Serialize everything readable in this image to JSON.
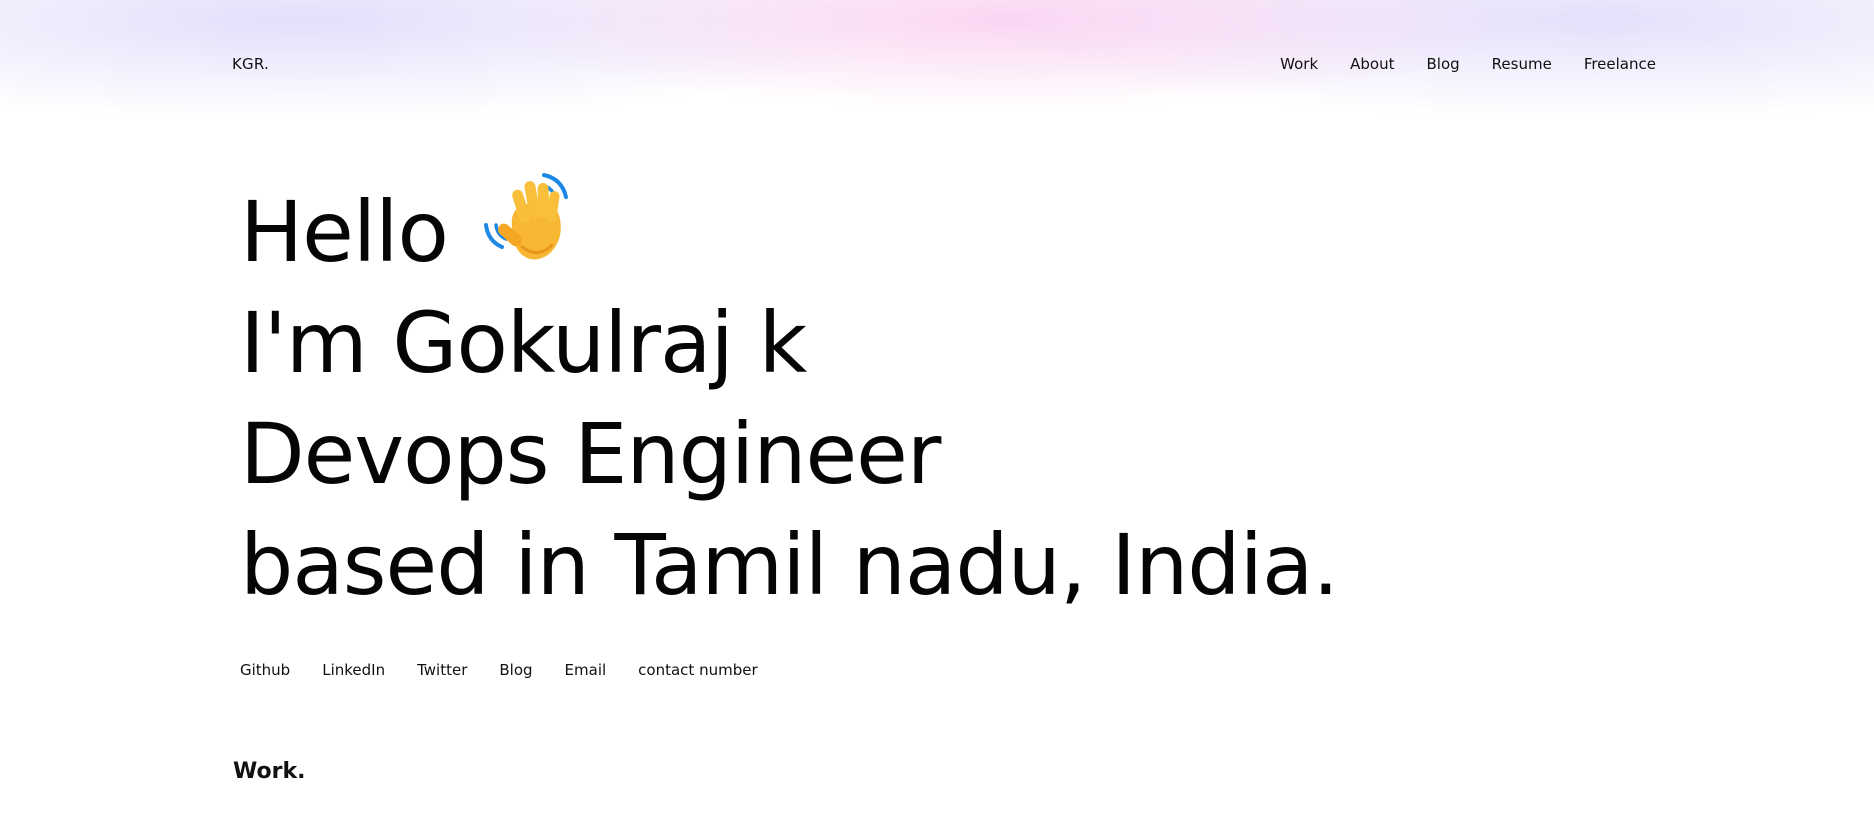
{
  "header": {
    "logo": "KGR.",
    "nav": [
      {
        "label": "Work"
      },
      {
        "label": "About"
      },
      {
        "label": "Blog"
      },
      {
        "label": "Resume"
      },
      {
        "label": "Freelance"
      }
    ]
  },
  "hero": {
    "line1": "Hello",
    "wave_icon": "waving-hand-icon",
    "line2": "I'm Gokulraj k",
    "line3": "Devops Engineer",
    "line4": "based in Tamil nadu, India."
  },
  "social_links": [
    {
      "label": "Github"
    },
    {
      "label": "LinkedIn"
    },
    {
      "label": "Twitter"
    },
    {
      "label": "Blog"
    },
    {
      "label": "Email"
    },
    {
      "label": "contact number"
    }
  ],
  "sections": {
    "work_title": "Work."
  },
  "colors": {
    "text": "#0c0c0c",
    "glow_pink": "#f9c8ee",
    "glow_lavender": "#dcd6fa",
    "wave_hand": "#f7b733",
    "wave_lines": "#1e88e5"
  }
}
